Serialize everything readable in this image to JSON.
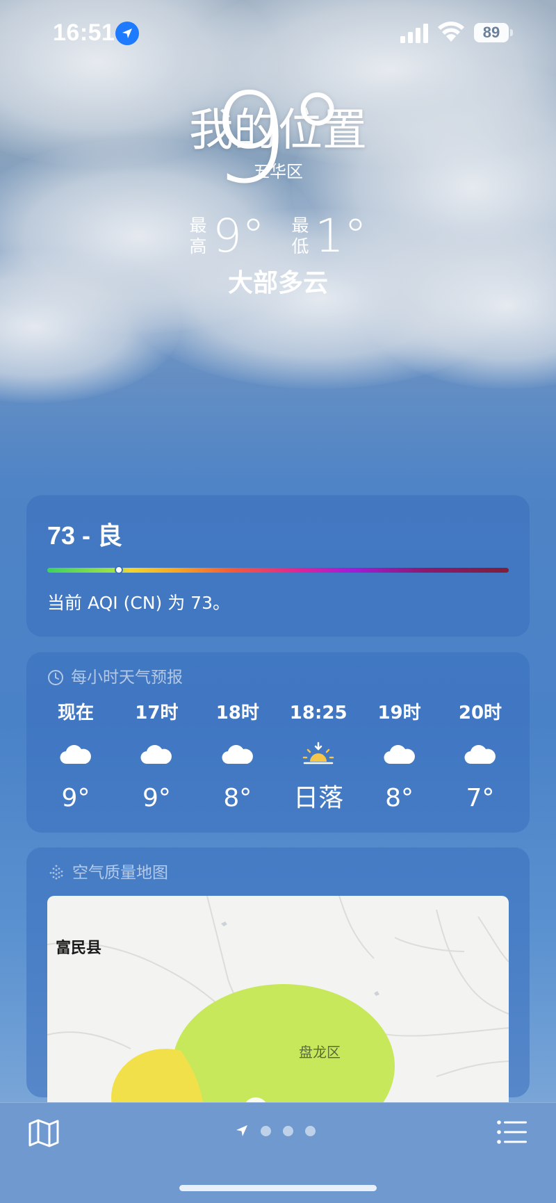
{
  "status_bar": {
    "time": "16:51",
    "battery": "89"
  },
  "location": {
    "title": "我的位置",
    "district": "五华区",
    "temperature": "9°",
    "high_label": "最高",
    "high_value": "9°",
    "low_label": "最低",
    "low_value": "1°",
    "condition": "大部多云"
  },
  "aqi": {
    "title": "73 - 良",
    "description": "当前 AQI (CN) 为 73。",
    "index_fraction": 0.155
  },
  "hourly": {
    "header": "每小时天气预报",
    "items": [
      {
        "label": "现在",
        "icon": "cloud-icon",
        "temp": "9°"
      },
      {
        "label": "17时",
        "icon": "cloud-icon",
        "temp": "9°"
      },
      {
        "label": "18时",
        "icon": "cloud-icon",
        "temp": "8°"
      },
      {
        "label": "18:25",
        "icon": "sunset-icon",
        "temp": "日落"
      },
      {
        "label": "19时",
        "icon": "cloud-icon",
        "temp": "8°"
      },
      {
        "label": "20时",
        "icon": "cloud-icon",
        "temp": "7°"
      }
    ]
  },
  "air_map": {
    "header": "空气质量地图",
    "labels": {
      "fumin": "富民县",
      "panlong": "盘龙区"
    },
    "colors": {
      "good": "#c8e85c",
      "moderate": "#f2e04a"
    }
  },
  "colors": {
    "card_bg": "#3a70be",
    "accent_blue": "#1e7bff",
    "bottom_bar": "#6f99cf"
  }
}
